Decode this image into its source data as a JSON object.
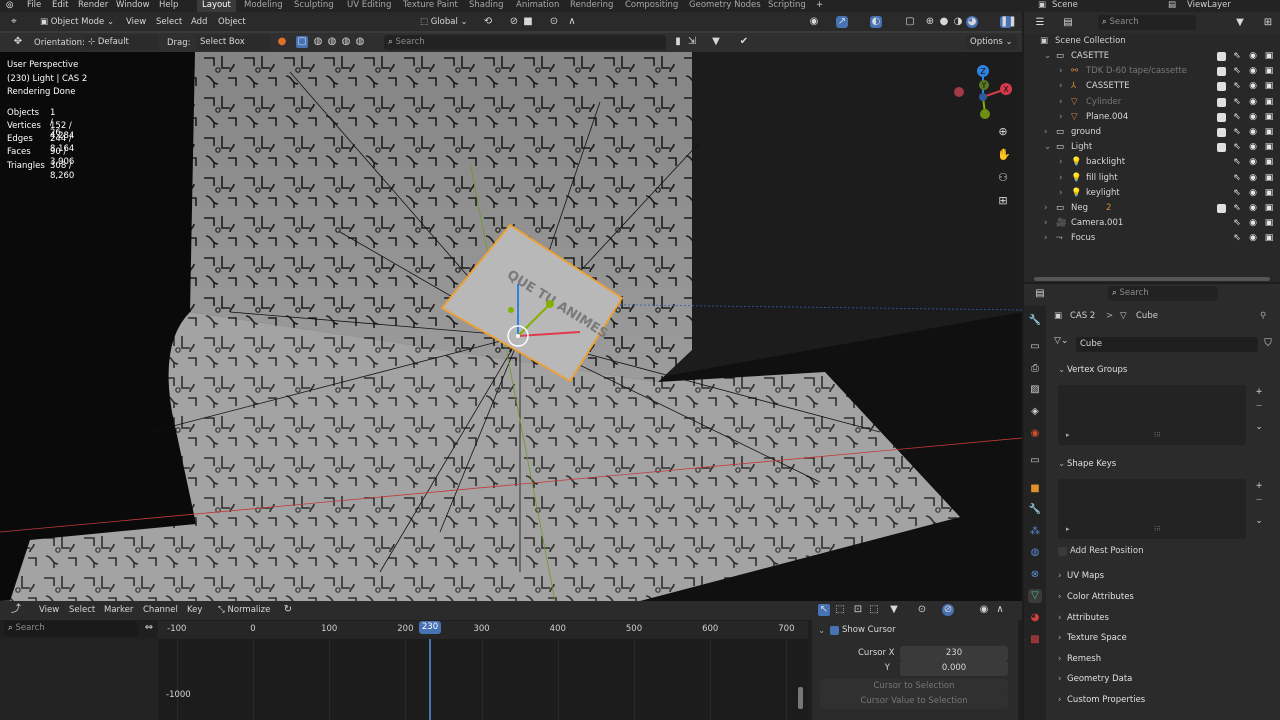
{
  "menu": [
    "File",
    "Edit",
    "Render",
    "Window",
    "Help"
  ],
  "workspaces": [
    "Layout",
    "Modeling",
    "Sculpting",
    "UV Editing",
    "Texture Paint",
    "Shading",
    "Animation",
    "Rendering",
    "Compositing",
    "Geometry Nodes",
    "Scripting"
  ],
  "workspace_add": "+",
  "scene_label": "Scene",
  "viewlayer_label": "ViewLayer",
  "viewport": {
    "mode": "Object Mode",
    "menus": [
      "View",
      "Select",
      "Add",
      "Object"
    ],
    "transform_orientation": "Global",
    "orientation_label": "Orientation:",
    "orientation_value": "Default",
    "drag_label": "Drag:",
    "drag_value": "Select Box",
    "search_placeholder": "Search",
    "options_label": "Options",
    "overlay": {
      "view_name": "User Perspective",
      "object_line": "(230) Light | CAS 2",
      "status": "Rendering Done"
    },
    "stats": [
      {
        "label": "Objects",
        "value": "1 / 26"
      },
      {
        "label": "Vertices",
        "value": "152 / 4,284"
      },
      {
        "label": "Edges",
        "value": "244 / 8,164"
      },
      {
        "label": "Faces",
        "value": "90 / 3,906"
      },
      {
        "label": "Triangles",
        "value": "308 / 8,260"
      }
    ],
    "gizmo": {
      "x": "X",
      "y": "Y",
      "z": "Z"
    },
    "object_text": "QUE TU ANIMES"
  },
  "outliner": {
    "search_placeholder": "Search",
    "root": "Scene Collection",
    "rows": [
      {
        "name": "CASETTE",
        "indent": 0,
        "kind": "collection",
        "dim": false
      },
      {
        "name": "TDK D-60 tape/cassette",
        "indent": 1,
        "kind": "object",
        "dim": true
      },
      {
        "name": "CASSETTE",
        "indent": 1,
        "kind": "armature",
        "dim": false
      },
      {
        "name": "Cylinder",
        "indent": 1,
        "kind": "mesh",
        "dim": true
      },
      {
        "name": "Plane.004",
        "indent": 1,
        "kind": "mesh",
        "dim": false
      },
      {
        "name": "ground",
        "indent": 0,
        "kind": "collection",
        "dim": false
      },
      {
        "name": "Light",
        "indent": 0,
        "kind": "collection",
        "dim": false
      },
      {
        "name": "backlight",
        "indent": 1,
        "kind": "light",
        "dim": false
      },
      {
        "name": "fill light",
        "indent": 1,
        "kind": "light",
        "dim": false
      },
      {
        "name": "keylight",
        "indent": 1,
        "kind": "light",
        "dim": false
      },
      {
        "name": "Neg",
        "indent": 0,
        "kind": "collection",
        "dim": false
      },
      {
        "name": "Camera.001",
        "indent": 0,
        "kind": "camera",
        "dim": false
      },
      {
        "name": "Focus",
        "indent": 0,
        "kind": "empty",
        "dim": false
      }
    ],
    "neg_badge": "2"
  },
  "properties": {
    "search_placeholder": "Search",
    "breadcrumb_object": "CAS 2",
    "breadcrumb_sep": ">",
    "breadcrumb_data": "Cube",
    "mesh_name": "Cube",
    "panels": {
      "vertex_groups": "Vertex Groups",
      "shape_keys": "Shape Keys",
      "add_rest_position": "Add Rest Position",
      "uv_maps": "UV Maps",
      "color_attributes": "Color Attributes",
      "attributes": "Attributes",
      "texture_space": "Texture Space",
      "remesh": "Remesh",
      "geometry_data": "Geometry Data",
      "custom_properties": "Custom Properties"
    },
    "plus": "+",
    "minus": "−"
  },
  "timeline": {
    "menus": [
      "View",
      "Select",
      "Marker",
      "Channel",
      "Key"
    ],
    "normalize": "Normalize",
    "search_placeholder": "Search",
    "ticks": [
      "-100",
      "0",
      "100",
      "200",
      "300",
      "400",
      "500",
      "600",
      "700"
    ],
    "current_frame": "230",
    "y_tick": "-1000",
    "show_cursor": "Show Cursor",
    "cursor_x_label": "Cursor X",
    "cursor_x_value": "230",
    "cursor_y_label": "Y",
    "cursor_y_value": "0.000",
    "cursor_to_selection": "Cursor to Selection",
    "cursor_value_to_selection": "Cursor Value to Selection"
  },
  "colors": {
    "accent": "#4772b3",
    "selection_outline": "#f0a030",
    "axis_x": "#d63a4a",
    "axis_y": "#84b000",
    "axis_z": "#2f83e0"
  }
}
